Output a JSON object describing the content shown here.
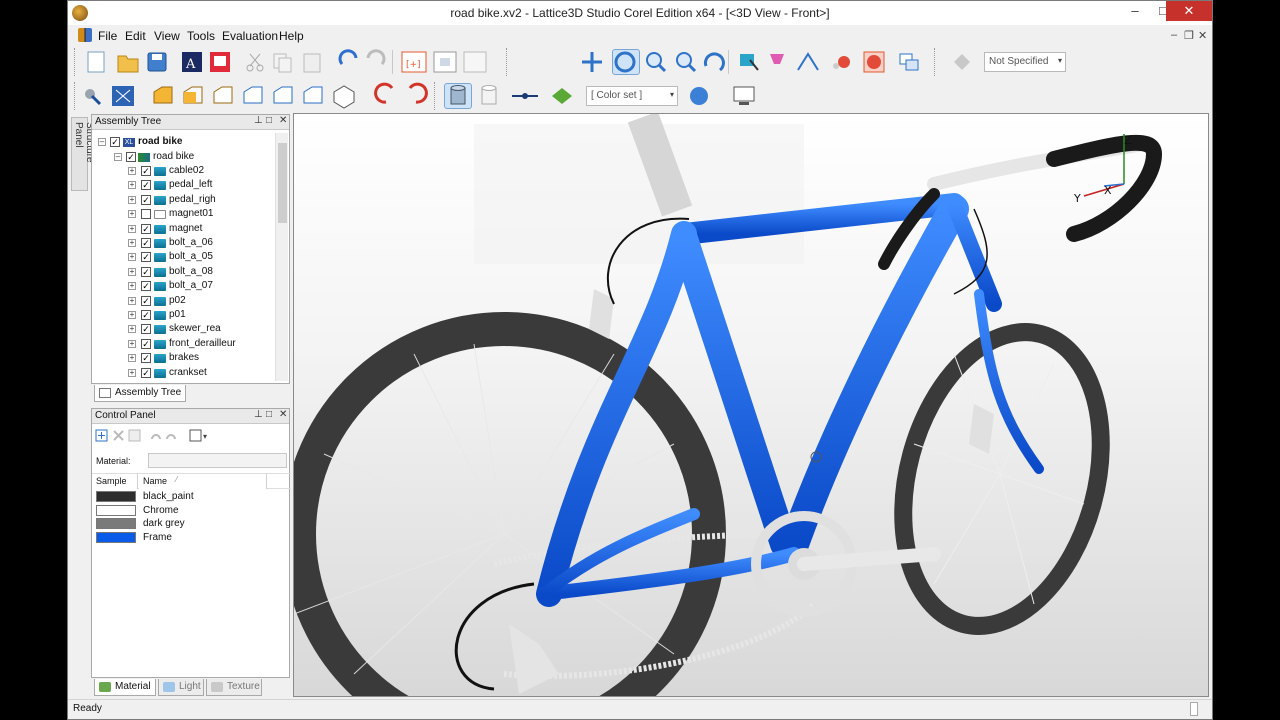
{
  "window": {
    "title": "road bike.xv2 - Lattice3D Studio Corel Edition x64 - [<3D View - Front>]",
    "minimize": "–",
    "maximize": "□",
    "close": "✕",
    "mdi_min": "–",
    "mdi_restore": "❐",
    "mdi_close": "✕"
  },
  "menu": [
    "File",
    "Edit",
    "View",
    "Tools",
    "Evaluation",
    "Help"
  ],
  "toolbar": {
    "material_combo": "Not Specified",
    "color_set_combo": "[ Color set ]"
  },
  "structure_panel_tab": "Structure Panel",
  "assembly_tree": {
    "title": "Assembly Tree",
    "root": "road bike",
    "assembly": "road bike",
    "items": [
      {
        "label": "cable02",
        "checked": true
      },
      {
        "label": "pedal_left",
        "checked": true
      },
      {
        "label": "pedal_righ",
        "checked": true
      },
      {
        "label": "magnet01",
        "checked": false
      },
      {
        "label": "magnet",
        "checked": true
      },
      {
        "label": "bolt_a_06",
        "checked": true
      },
      {
        "label": "bolt_a_05",
        "checked": true
      },
      {
        "label": "bolt_a_08",
        "checked": true
      },
      {
        "label": "bolt_a_07",
        "checked": true
      },
      {
        "label": "p02",
        "checked": true
      },
      {
        "label": "p01",
        "checked": true
      },
      {
        "label": "skewer_rea",
        "checked": true
      },
      {
        "label": "front_derailleur",
        "checked": true
      },
      {
        "label": "brakes",
        "checked": true
      },
      {
        "label": "crankset",
        "checked": true
      }
    ],
    "tab_label": "Assembly Tree"
  },
  "control_panel": {
    "title": "Control Panel",
    "material_label": "Material:",
    "columns": [
      "Sample",
      "Name"
    ],
    "materials": [
      {
        "name": "black_paint",
        "color": "#2e2e2e"
      },
      {
        "name": "Chrome",
        "color": "#ffffff"
      },
      {
        "name": "dark grey",
        "color": "#7a7a7a"
      },
      {
        "name": "Frame",
        "color": "#0a5be8"
      }
    ],
    "tabs": [
      "Material",
      "Light",
      "Texture"
    ]
  },
  "viewport": {
    "axis_labels": {
      "z": "Z",
      "y": "Y",
      "x": "X"
    },
    "frame_color": "#0b5ee8"
  },
  "status": {
    "text": "Ready"
  }
}
